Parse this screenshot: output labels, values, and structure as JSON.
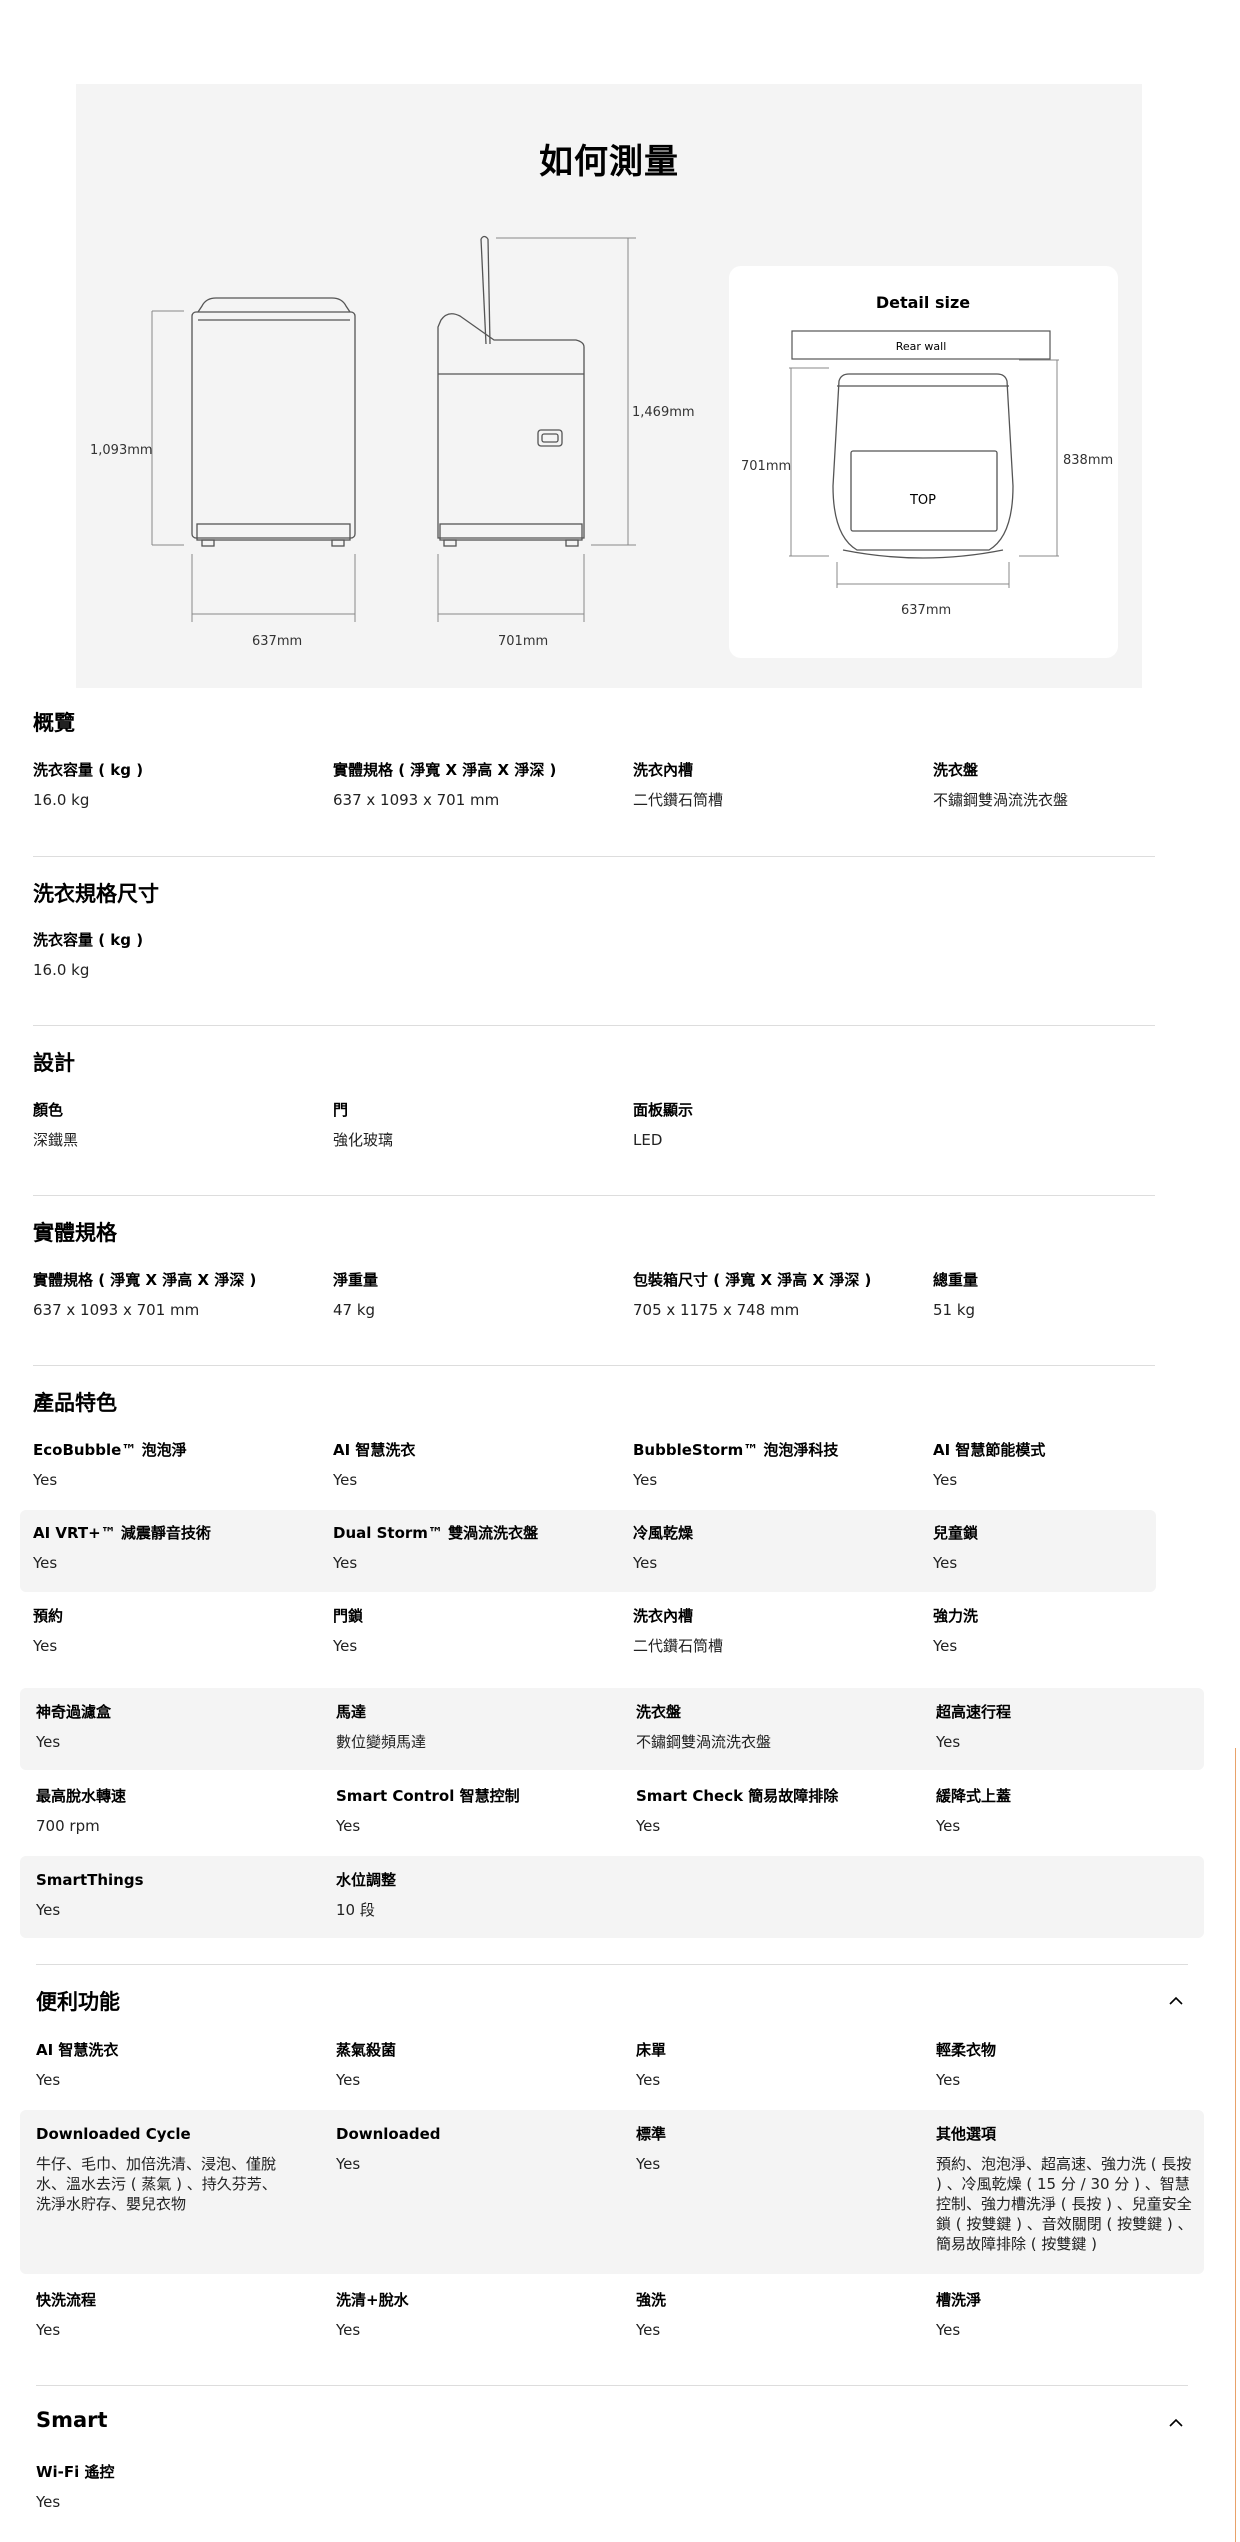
{
  "measure": {
    "title": "如何測量",
    "dims": {
      "front_height": "1,093mm",
      "front_width": "637mm",
      "side_height": "1,469mm",
      "side_depth": "701mm"
    },
    "detail": {
      "title": "Detail size",
      "rear_wall": "Rear wall",
      "top": "TOP",
      "depth": "701mm",
      "width": "637mm",
      "depth_lid": "838mm"
    }
  },
  "overview": {
    "title": "概覽",
    "items": [
      {
        "label": "洗衣容量 ( kg )",
        "value": "16.0 kg"
      },
      {
        "label": "實體規格 ( 淨寬 X 淨高 X 淨深 )",
        "value": "637 x 1093 x 701 mm"
      },
      {
        "label": "洗衣內槽",
        "value": "二代鑽石筒槽"
      },
      {
        "label": "洗衣盤",
        "value": "不鏽鋼雙渦流洗衣盤"
      }
    ]
  },
  "wash_spec": {
    "title": "洗衣規格尺寸",
    "items": [
      {
        "label": "洗衣容量 ( kg )",
        "value": "16.0 kg"
      }
    ]
  },
  "design": {
    "title": "設計",
    "items": [
      {
        "label": "顏色",
        "value": "深鐵黑"
      },
      {
        "label": "門",
        "value": "強化玻璃"
      },
      {
        "label": "面板顯示",
        "value": "LED"
      }
    ]
  },
  "physical": {
    "title": "實體規格",
    "items": [
      {
        "label": "實體規格 ( 淨寬 X 淨高 X 淨深 )",
        "value": "637 x 1093 x 701 mm"
      },
      {
        "label": "淨重量",
        "value": "47 kg"
      },
      {
        "label": "包裝箱尺寸 ( 淨寬 X 淨高 X 淨深 )",
        "value": "705 x 1175 x 748 mm"
      },
      {
        "label": "總重量",
        "value": "51 kg"
      }
    ]
  },
  "features": {
    "title": "產品特色",
    "rows": [
      [
        {
          "label": "EcoBubble™ 泡泡淨",
          "value": "Yes"
        },
        {
          "label": "AI 智慧洗衣",
          "value": "Yes"
        },
        {
          "label": "BubbleStorm™ 泡泡淨科技",
          "value": "Yes"
        },
        {
          "label": "AI 智慧節能模式",
          "value": "Yes"
        }
      ],
      [
        {
          "label": "AI VRT+™ 減震靜音技術",
          "value": "Yes"
        },
        {
          "label": "Dual Storm™ 雙渦流洗衣盤",
          "value": "Yes"
        },
        {
          "label": "冷風乾燥",
          "value": "Yes"
        },
        {
          "label": "兒童鎖",
          "value": "Yes"
        }
      ],
      [
        {
          "label": "預約",
          "value": "Yes"
        },
        {
          "label": "門鎖",
          "value": "Yes"
        },
        {
          "label": "洗衣內槽",
          "value": "二代鑽石筒槽"
        },
        {
          "label": "強力洗",
          "value": "Yes"
        }
      ],
      [
        {
          "label": "神奇過濾盒",
          "value": "Yes"
        },
        {
          "label": "馬達",
          "value": "數位變頻馬達"
        },
        {
          "label": "洗衣盤",
          "value": "不鏽鋼雙渦流洗衣盤"
        },
        {
          "label": "超高速行程",
          "value": "Yes"
        }
      ],
      [
        {
          "label": "最高脫水轉速",
          "value": "700 rpm"
        },
        {
          "label": "Smart Control 智慧控制",
          "value": "Yes"
        },
        {
          "label": "Smart Check 簡易故障排除",
          "value": "Yes"
        },
        {
          "label": "緩降式上蓋",
          "value": "Yes"
        }
      ],
      [
        {
          "label": "SmartThings",
          "value": "Yes"
        },
        {
          "label": "水位調整",
          "value": "10 段"
        }
      ]
    ]
  },
  "convenience": {
    "title": "便利功能",
    "rows": [
      [
        {
          "label": "AI 智慧洗衣",
          "value": "Yes"
        },
        {
          "label": "蒸氣殺菌",
          "value": "Yes"
        },
        {
          "label": "床單",
          "value": "Yes"
        },
        {
          "label": "輕柔衣物",
          "value": "Yes"
        }
      ],
      [
        {
          "label": "Downloaded Cycle",
          "value": "牛仔、毛巾、加倍洗清、浸泡、僅脫水、溫水去污 ( 蒸氣 ) 、持久芬芳、洗淨水貯存、嬰兒衣物"
        },
        {
          "label": "Downloaded",
          "value": "Yes"
        },
        {
          "label": "標準",
          "value": "Yes"
        },
        {
          "label": "其他選項",
          "value": "預約、泡泡淨、超高速、強力洗 ( 長按 ) 、冷風乾燥 ( 15 分 / 30 分 ) 、智慧控制、強力槽洗淨 ( 長按 ) 、兒童安全鎖 ( 按雙鍵 ) 、音效關閉 ( 按雙鍵 ) 、簡易故障排除 ( 按雙鍵 )"
        }
      ],
      [
        {
          "label": "快洗流程",
          "value": "Yes"
        },
        {
          "label": "洗清+脫水",
          "value": "Yes"
        },
        {
          "label": "強洗",
          "value": "Yes"
        },
        {
          "label": "槽洗淨",
          "value": "Yes"
        }
      ]
    ]
  },
  "smart": {
    "title": "Smart",
    "items": [
      {
        "label": "Wi-Fi 遙控",
        "value": "Yes"
      }
    ]
  }
}
